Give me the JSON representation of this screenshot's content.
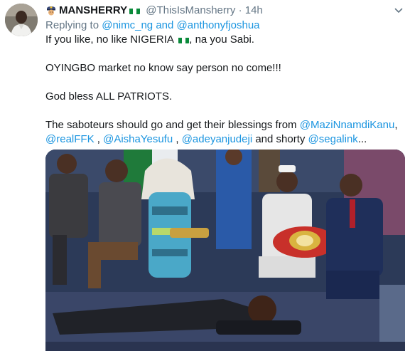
{
  "tweet": {
    "author_name": "MANSHERRY",
    "author_handle": "@ThisIsMansherry",
    "separator": "·",
    "time": "14h",
    "replying_prefix": "Replying to",
    "reply_to_1": "@nimc_ng",
    "reply_and": "and",
    "reply_to_2": "@anthonyfjoshua",
    "line1_a": "If you like, no like NIGERIA",
    "line1_b": ", na you Sabi.",
    "line2": "OYINGBO market no know say person no come!!!",
    "line3": "God bless ALL PATRIOTS.",
    "line4_a": "The saboteurs should go and get their blessings from",
    "mention_1": "@MaziNnamdiKanu",
    "mention_2": "@realFFK",
    "mention_3": "@AishaYesufu",
    "mention_4": "@adeyanjudeji",
    "line5_comma": ",",
    "line5_and": "and shorty",
    "mention_5": "@segalink",
    "line5_end": "..."
  },
  "icons": {
    "name_emoji": "police-officer-emoji",
    "flag": "nigeria-flag-emoji",
    "more": "chevron-down-icon"
  },
  "colors": {
    "link": "#1b95e0",
    "muted": "#657786",
    "text": "#14171a"
  }
}
